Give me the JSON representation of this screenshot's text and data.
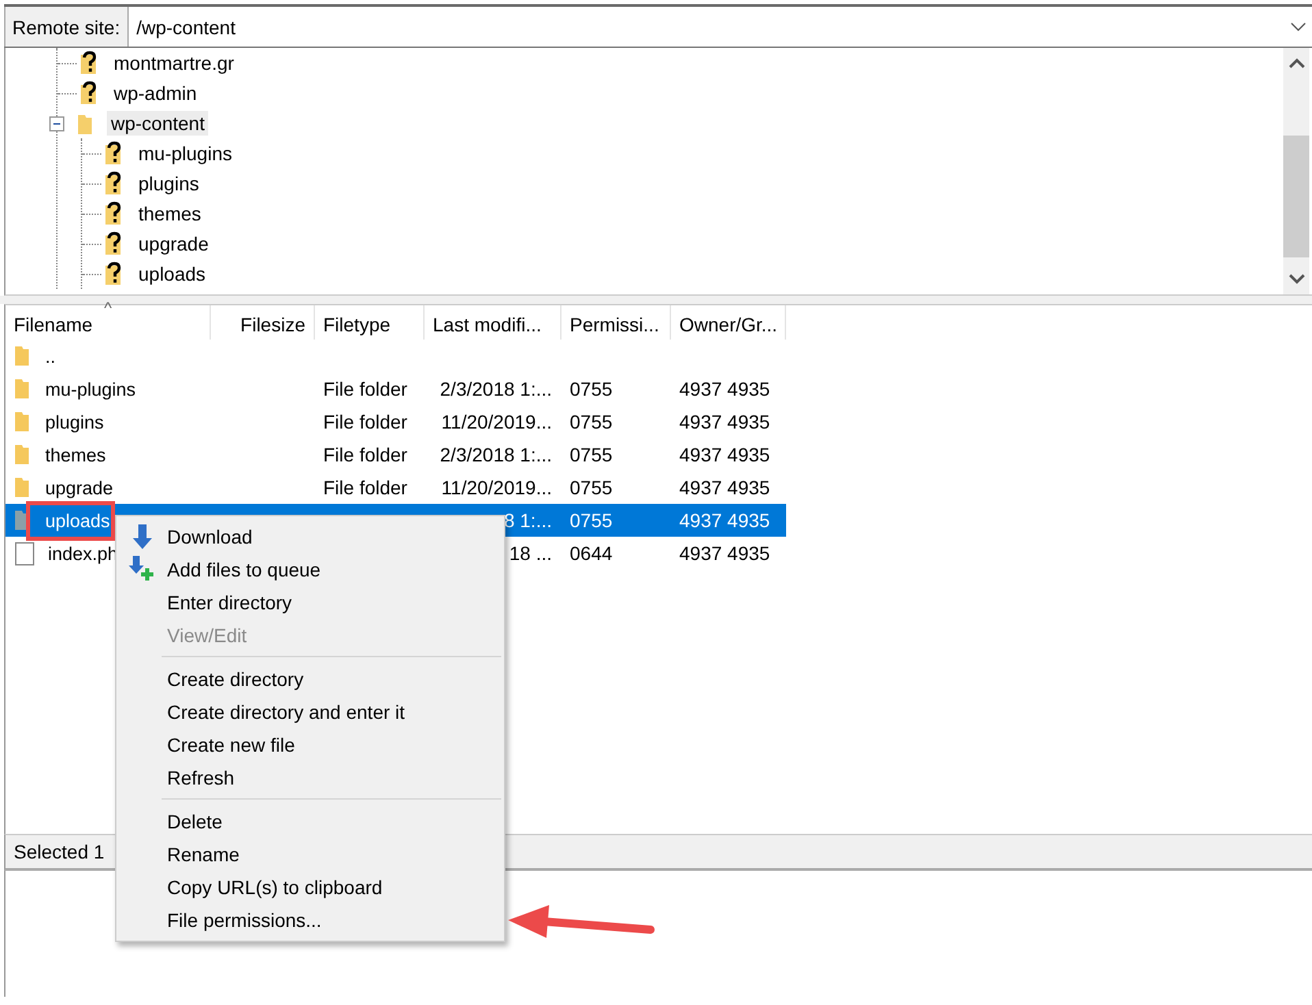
{
  "remote_site": {
    "label": "Remote site:",
    "path": "/wp-content"
  },
  "tree": [
    {
      "name": "montmartre.gr",
      "kind": "unknown",
      "selected": false
    },
    {
      "name": "wp-admin",
      "kind": "unknown",
      "selected": false
    },
    {
      "name": "wp-content",
      "kind": "folder",
      "selected": true,
      "expanded": true,
      "children": [
        {
          "name": "mu-plugins",
          "kind": "unknown",
          "selected": false
        },
        {
          "name": "plugins",
          "kind": "unknown",
          "selected": false
        },
        {
          "name": "themes",
          "kind": "unknown",
          "selected": false
        },
        {
          "name": "upgrade",
          "kind": "unknown",
          "selected": false
        },
        {
          "name": "uploads",
          "kind": "unknown",
          "selected": false
        }
      ]
    }
  ],
  "table": {
    "columns": [
      "Filename",
      "Filesize",
      "Filetype",
      "Last modifi...",
      "Permissi...",
      "Owner/Gr..."
    ],
    "sort_indicator": "^",
    "rows": [
      {
        "kind": "parent",
        "cells": [
          "..",
          "",
          "",
          "",
          "",
          ""
        ],
        "selected": false
      },
      {
        "kind": "folder",
        "cells": [
          "mu-plugins",
          "",
          "File folder",
          "2/3/2018 1:...",
          "0755",
          "4937 4935"
        ],
        "selected": false
      },
      {
        "kind": "folder",
        "cells": [
          "plugins",
          "",
          "File folder",
          "11/20/2019...",
          "0755",
          "4937 4935"
        ],
        "selected": false
      },
      {
        "kind": "folder",
        "cells": [
          "themes",
          "",
          "File folder",
          "2/3/2018 1:...",
          "0755",
          "4937 4935"
        ],
        "selected": false
      },
      {
        "kind": "folder",
        "cells": [
          "upgrade",
          "",
          "File folder",
          "11/20/2019...",
          "0755",
          "4937 4935"
        ],
        "selected": false
      },
      {
        "kind": "folder",
        "cells": [
          "uploads",
          "",
          "",
          "8 1:...",
          "0755",
          "4937 4935"
        ],
        "selected": true
      },
      {
        "kind": "file",
        "cells": [
          "index.ph",
          "",
          "",
          "18 ...",
          "0644",
          "4937 4935"
        ],
        "selected": false
      }
    ]
  },
  "status_bar": "Selected 1",
  "context_menu": [
    {
      "kind": "download",
      "label": "Download",
      "disabled": false
    },
    {
      "kind": "enqueue",
      "label": "Add files to queue",
      "disabled": false
    },
    {
      "kind": "plain",
      "label": "Enter directory",
      "disabled": false
    },
    {
      "kind": "plain",
      "label": "View/Edit",
      "disabled": true
    },
    {
      "kind": "separator"
    },
    {
      "kind": "plain",
      "label": "Create directory",
      "disabled": false
    },
    {
      "kind": "plain",
      "label": "Create directory and enter it",
      "disabled": false
    },
    {
      "kind": "plain",
      "label": "Create new file",
      "disabled": false
    },
    {
      "kind": "plain",
      "label": "Refresh",
      "disabled": false
    },
    {
      "kind": "separator"
    },
    {
      "kind": "plain",
      "label": "Delete",
      "disabled": false
    },
    {
      "kind": "plain",
      "label": "Rename",
      "disabled": false
    },
    {
      "kind": "plain",
      "label": "Copy URL(s) to clipboard",
      "disabled": false
    },
    {
      "kind": "plain",
      "label": "File permissions...",
      "disabled": false
    }
  ]
}
